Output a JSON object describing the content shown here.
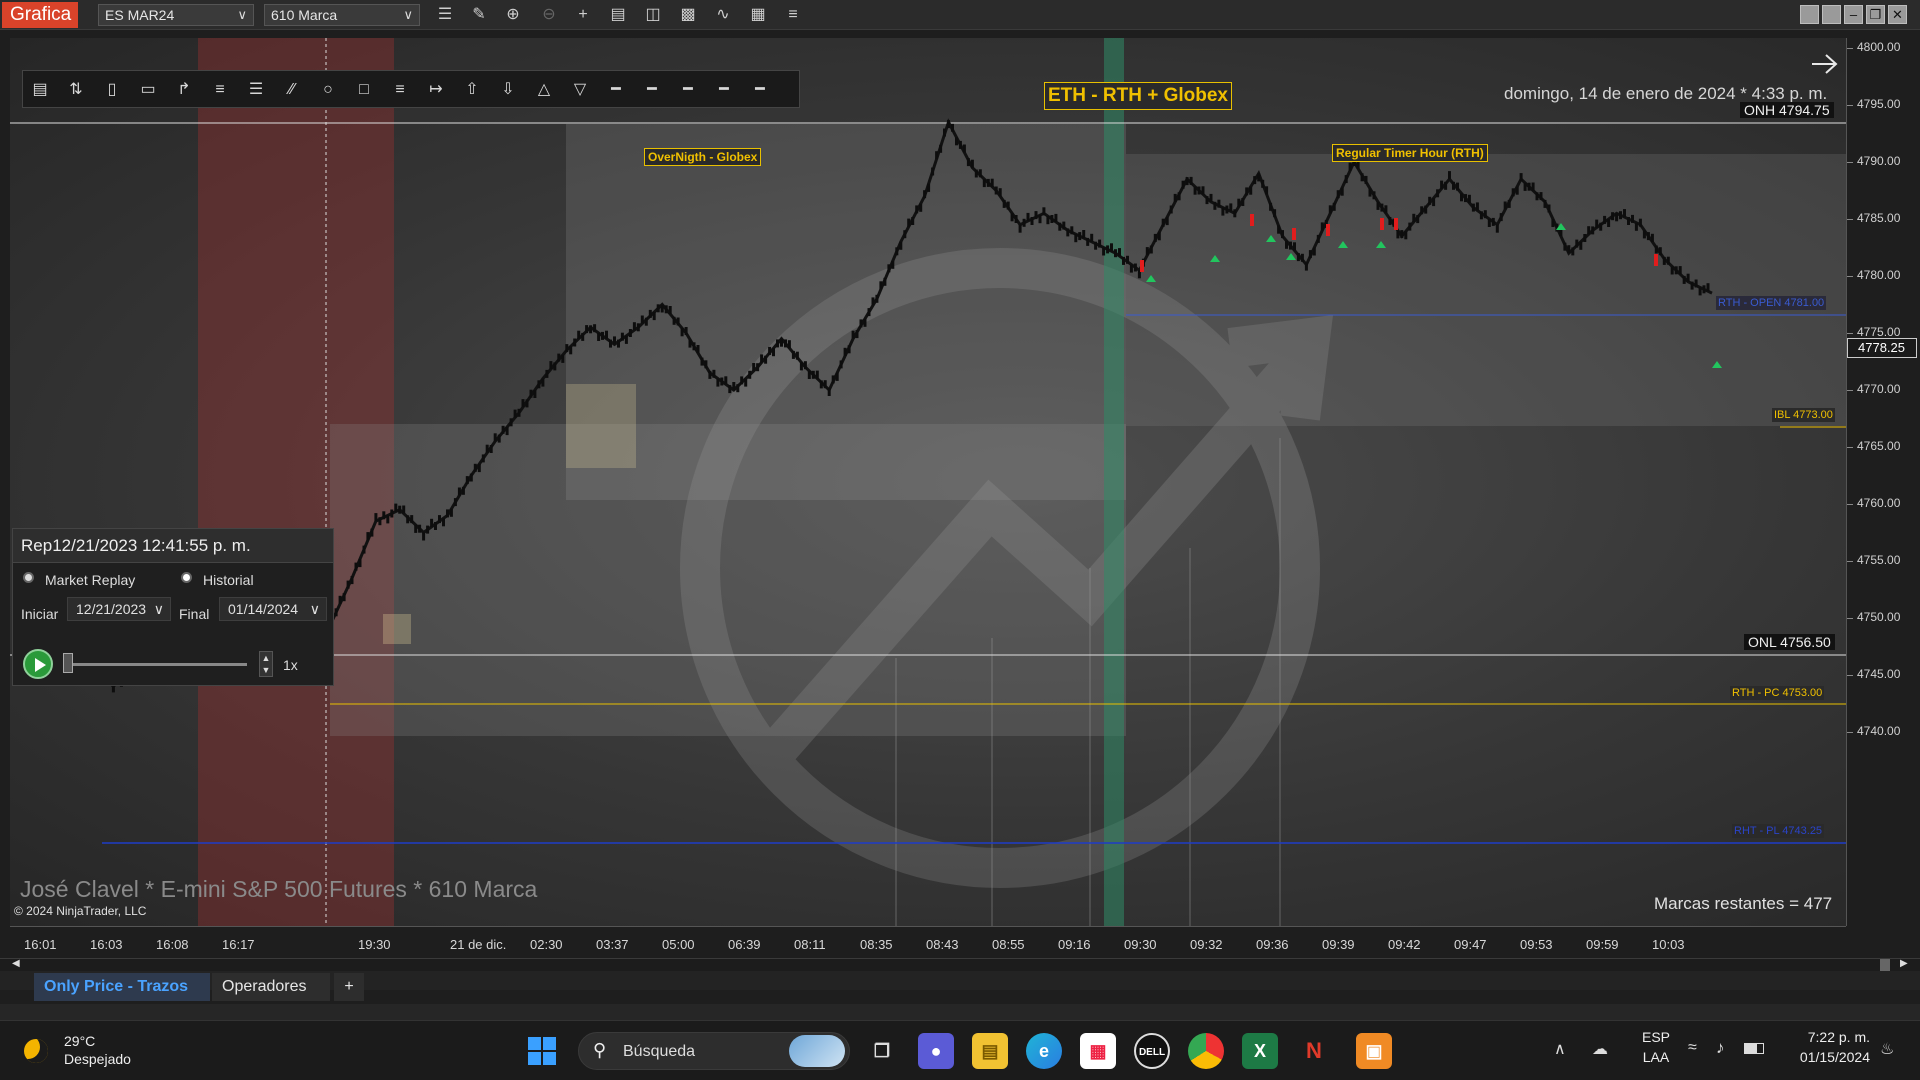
{
  "app": {
    "name": "Grafica",
    "instrument": "ES MAR24",
    "period": "610 Marca"
  },
  "chart": {
    "header_title": "ETH - RTH + Globex",
    "date_label": "domingo, 14 de enero de 2024 * 4:33 p. m.",
    "overnight_label": "OverNigth - Globex",
    "rth_label": "Regular Timer Hour (RTH)",
    "watermark_text": "José Clavel * E-mini S&P 500 Futures * 610 Marca",
    "copyright": "© 2024 NinjaTrader, LLC",
    "remaining_marks": "Marcas restantes = 477",
    "levels": {
      "onh": "ONH 4794.75",
      "onl": "ONL 4756.50",
      "rth_open": "RTH - OPEN 4781.00",
      "ibl": "IBL 4773.00",
      "rth_pc": "RTH - PC 4753.00",
      "rht_pl": "RHT - PL 4743.25",
      "last_price": "4778.25"
    }
  },
  "chart_data": {
    "type": "line",
    "title": "ETH - RTH + Globex",
    "x_ticks": [
      "16:01",
      "16:03",
      "16:08",
      "16:17",
      "19:30",
      "21 de dic.",
      "02:30",
      "03:37",
      "05:00",
      "06:39",
      "08:11",
      "08:35",
      "08:43",
      "08:55",
      "09:16",
      "09:30",
      "09:32",
      "09:36",
      "09:39",
      "09:42",
      "09:47",
      "09:53",
      "09:59",
      "10:03"
    ],
    "y_ticks": [
      "4800.00",
      "4795.00",
      "4790.00",
      "4785.00",
      "4780.00",
      "4775.00",
      "4770.00",
      "4765.00",
      "4760.00",
      "4755.00",
      "4750.00",
      "4745.00",
      "4740.00"
    ],
    "ylim": [
      4738,
      4800
    ],
    "series": [
      {
        "values": [
          4749.5,
          4748.5,
          4747.5,
          4746,
          4744,
          4746,
          4748,
          4749,
          4746.5,
          4745.5,
          4746.5,
          4748,
          4750.5,
          4749,
          4753.5,
          4758.5,
          4759.5,
          4757.5,
          4759,
          4762.5,
          4765.5,
          4768,
          4771,
          4773.5,
          4775.5,
          4774,
          4775.5,
          4777.5,
          4775,
          4771.5,
          4770,
          4772,
          4774.5,
          4772,
          4770,
          4774.5,
          4778,
          4783,
          4787,
          4793.5,
          4789.5,
          4787.5,
          4784.5,
          4785.5,
          4784,
          4783,
          4782,
          4780.5,
          4784.5,
          4788.5,
          4786.5,
          4785.5,
          4789,
          4783.5,
          4781,
          4785.5,
          4790,
          4786.5,
          4783.5,
          4786,
          4788.5,
          4786,
          4784.5,
          4788.5,
          4786.5,
          4782,
          4784,
          4785.5,
          4784.5,
          4781.5,
          4779.5,
          4778.5
        ]
      }
    ]
  },
  "y_axis": {
    "ticks": [
      "4800.00",
      "4795.00",
      "4790.00",
      "4785.00",
      "4780.00",
      "4775.00",
      "4770.00",
      "4765.00",
      "4760.00",
      "4755.00",
      "4750.00",
      "4745.00",
      "4740.00"
    ],
    "last_price": "4778.25"
  },
  "x_axis": {
    "ticks": [
      "16:01",
      "16:03",
      "16:08",
      "16:17",
      "19:30",
      "21 de dic.",
      "02:30",
      "03:37",
      "05:00",
      "06:39",
      "08:11",
      "08:35",
      "08:43",
      "08:55",
      "09:16",
      "09:30",
      "09:32",
      "09:36",
      "09:39",
      "09:42",
      "09:47",
      "09:53",
      "09:59",
      "10:03"
    ]
  },
  "replay": {
    "title": "Rep",
    "current_datetime": "12/21/2023 12:41:55 p. m.",
    "option_market_replay": "Market Replay",
    "option_historial": "Historial",
    "start_label": "Iniciar",
    "start_date": "12/21/2023",
    "end_label": "Final",
    "end_date": "01/14/2024",
    "speed": "1x"
  },
  "tabs": {
    "tab1": "Only Price - Trazos",
    "tab2": "Operadores",
    "add": "+"
  },
  "taskbar": {
    "weather_temp": "29°C",
    "weather_desc": "Despejado",
    "search_placeholder": "Búsqueda",
    "lang_top": "ESP",
    "lang_bottom": "LAA",
    "time": "7:22 p. m.",
    "date": "01/15/2024"
  },
  "colors": {
    "accent": "#d9432a",
    "level_yellow": "#f0c000",
    "level_blue": "#2a44c8",
    "up_arrow": "#22c55e",
    "down_arrow": "#e11d1d",
    "session_red": "#a83232",
    "session_green": "#2f8a66"
  }
}
